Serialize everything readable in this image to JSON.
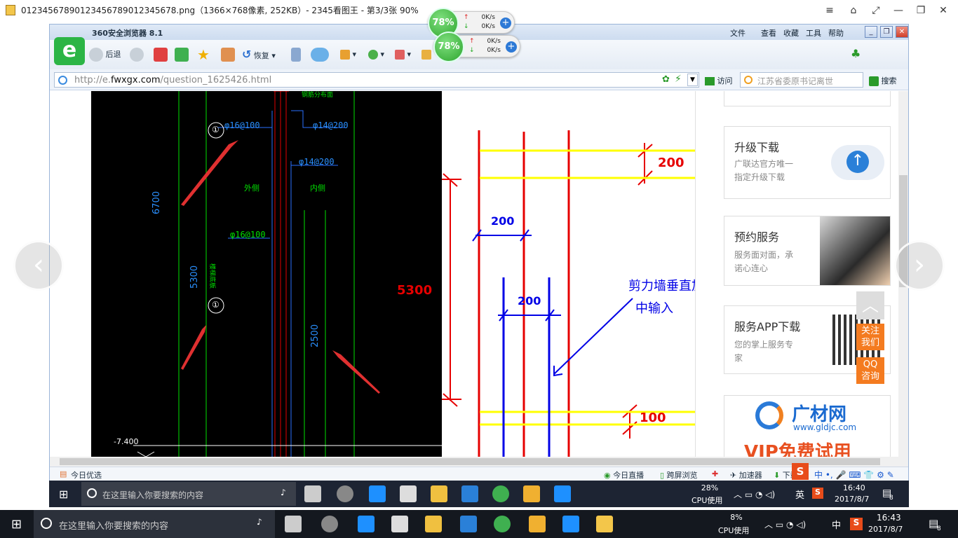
{
  "viewer": {
    "title": "01234567890123456789012345678.png（1366×768像素, 252KB）- 2345看图王 - 第3/3张 90%"
  },
  "speed_widgets": [
    {
      "percent": "78%",
      "up": "0K/s",
      "down": "0K/s"
    },
    {
      "percent": "78%",
      "up": "0K/s",
      "down": "0K/s"
    }
  ],
  "browser": {
    "title": "360安全浏览器 8.1",
    "menu": [
      "文件",
      "查看",
      "收藏",
      "工具",
      "帮助"
    ],
    "toolbar": {
      "back": "后退",
      "restore": "恢复"
    },
    "url_prefix": "http://e.",
    "url_domain": "fwxgx.com",
    "url_path": "/question_1625426.html",
    "visit_label": "访问",
    "search_placeholder": "江苏省委原书记离世",
    "search_label": "搜索",
    "status_left": "今日优选",
    "status_items": [
      "今日直播",
      "跨屏浏览",
      "加速器",
      "下载"
    ]
  },
  "cad": {
    "labels": [
      "φ16@100",
      "φ14@200",
      "φ14@200",
      "φ16@100",
      "外侧",
      "内侧",
      "6700",
      "5300",
      "2500",
      "-7.400",
      "①",
      "①",
      "钢筋分布面",
      "楼梯底板"
    ]
  },
  "drawing": {
    "dim_top": "200",
    "dim_left_bar": "200",
    "dim_mid": "200",
    "dim_height": "5300",
    "dim_bottom": "100",
    "annotation_line1": "剪力墙垂直加强筋在其它钢筋",
    "annotation_line2": "中输入"
  },
  "sidebar": {
    "card1": {
      "title": "升级下载",
      "desc1": "广联达官方唯一",
      "desc2": "指定升级下载"
    },
    "card2": {
      "title": "预约服务",
      "desc1": "服务面对面，承",
      "desc2": "诺心连心"
    },
    "card3": {
      "title": "服务APP下载",
      "desc1": "您的掌上服务专",
      "desc2": "家"
    },
    "ad": {
      "brand": "广材网",
      "url": "www.gldjc.com",
      "slogan": "VIP免费试用"
    },
    "float_follow": "关注\n我们",
    "float_qq": "QQ\n咨询"
  },
  "inner_taskbar": {
    "search_placeholder": "在这里输入你要搜索的内容",
    "cpu_percent": "28%",
    "cpu_label": "CPU使用",
    "ime": "英",
    "time": "16:40",
    "date": "2017/8/7",
    "notif_count": "8"
  },
  "outer_taskbar": {
    "search_placeholder": "在这里输入你要搜索的内容",
    "cpu_percent": "8%",
    "cpu_label": "CPU使用",
    "ime": "中",
    "time": "16:43",
    "date": "2017/8/7",
    "notif_count": "8"
  },
  "colors": {
    "cad_bg": "#000000",
    "rebar_red": "#e60000",
    "rebar_blue": "#0000e6",
    "dim_yellow": "#ffff00",
    "taskbar": "#14181f",
    "orange_float": "#f47b20"
  }
}
